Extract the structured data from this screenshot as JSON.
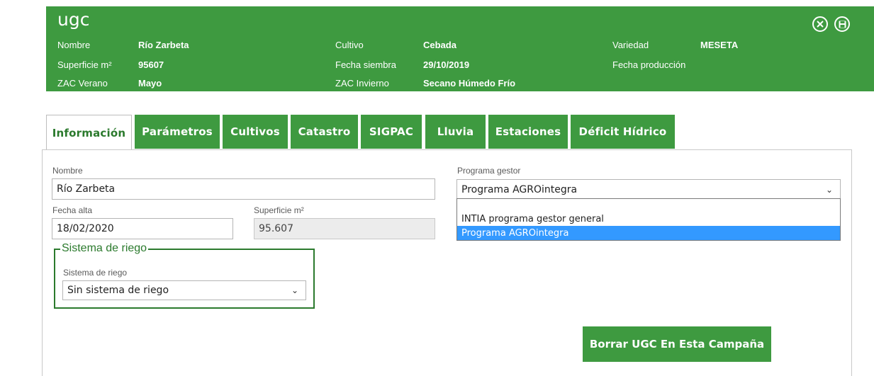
{
  "header": {
    "title": "ugc",
    "fields": {
      "nombre": {
        "label": "Nombre",
        "value": "Río Zarbeta"
      },
      "superficie": {
        "label": "Superficie m²",
        "value": "95607"
      },
      "zac_verano": {
        "label": "ZAC Verano",
        "value": "Mayo"
      },
      "cultivo": {
        "label": "Cultivo",
        "value": "Cebada"
      },
      "fecha_siembra": {
        "label": "Fecha siembra",
        "value": "29/10/2019"
      },
      "zac_invierno": {
        "label": "ZAC Invierno",
        "value": "Secano Húmedo Frío"
      },
      "variedad": {
        "label": "Variedad",
        "value": "MESETA"
      },
      "fecha_produccion": {
        "label": "Fecha producción",
        "value": ""
      }
    },
    "icons": {
      "close": "close-icon",
      "save": "save-icon"
    }
  },
  "tabs": [
    {
      "label": "Información",
      "active": true
    },
    {
      "label": "Parámetros",
      "active": false
    },
    {
      "label": "Cultivos",
      "active": false
    },
    {
      "label": "Catastro",
      "active": false
    },
    {
      "label": "SIGPAC",
      "active": false
    },
    {
      "label": "Lluvia",
      "active": false
    },
    {
      "label": "Estaciones",
      "active": false
    },
    {
      "label": "Déficit Hídrico",
      "active": false
    }
  ],
  "form": {
    "nombre": {
      "label": "Nombre",
      "value": "Río Zarbeta"
    },
    "fecha_alta": {
      "label": "Fecha alta",
      "value": "18/02/2020"
    },
    "superficie": {
      "label": "Superficie m²",
      "value": "95.607"
    },
    "sistema_riego_group": {
      "legend": "Sistema de riego",
      "label": "Sistema de riego",
      "value": "Sin sistema de riego"
    },
    "programa_gestor": {
      "label": "Programa gestor",
      "value": "Programa AGROintegra",
      "options": [
        "INTIA programa gestor general",
        "Programa AGROintegra"
      ],
      "selected_index": 1
    }
  },
  "actions": {
    "delete_label": "Borrar UGC En Esta Campaña"
  },
  "colors": {
    "brand_green": "#3e9a40",
    "dark_green": "#2b7a2d",
    "select_highlight": "#3399ff"
  }
}
